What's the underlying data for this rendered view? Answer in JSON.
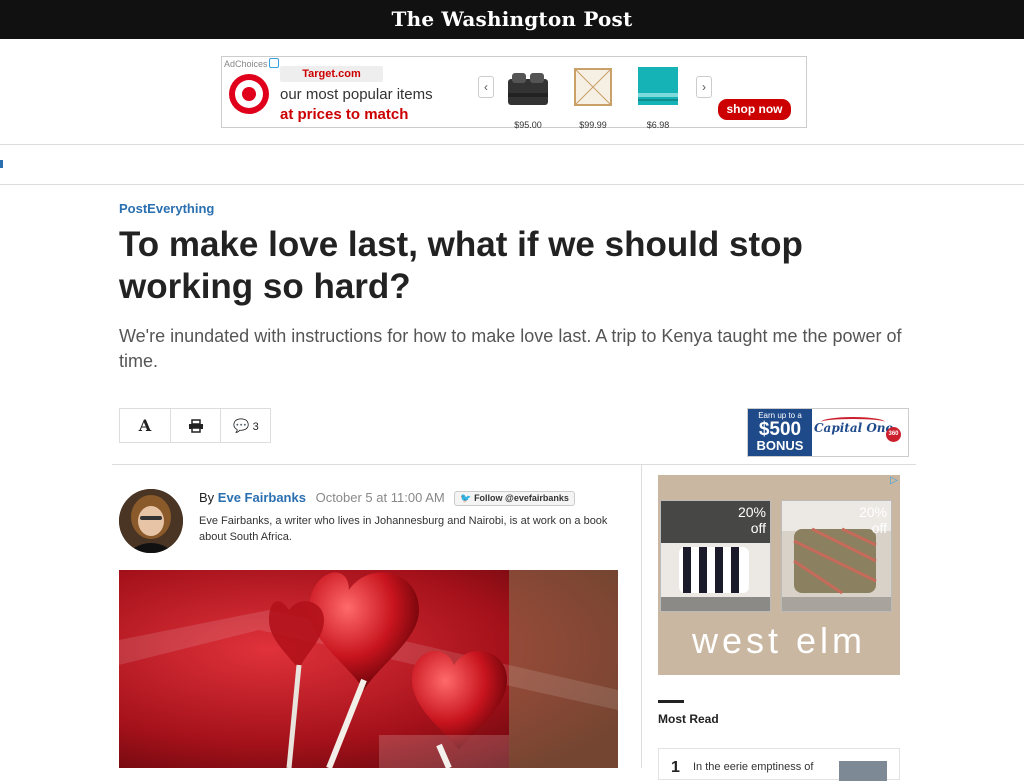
{
  "header": {
    "logo": "The Washington Post"
  },
  "ad_top": {
    "adchoices": "AdChoices",
    "advertiser_domain": "Target.com",
    "line1": "our most popular items",
    "line2": "at prices to match",
    "products": [
      {
        "price": "$95.00"
      },
      {
        "price": "$99.99"
      },
      {
        "price": "$6.98"
      }
    ],
    "prev": "‹",
    "next": "›",
    "cta": "shop now",
    "colors": {
      "brand": "#cc0000"
    }
  },
  "article": {
    "kicker": "PostEverything",
    "headline": "To make love last, what if we should stop working so hard?",
    "dek": "We're inundated with instructions for how to make love last. A trip to Kenya taught me the power of time.",
    "tools": {
      "font_icon": "A",
      "comment_count": "3"
    }
  },
  "capone_ad": {
    "small": "Earn up to a",
    "amount": "$500",
    "bonus": "BONUS",
    "brand": "Capital One",
    "badge": "360"
  },
  "byline": {
    "by": "By",
    "author": "Eve Fairbanks",
    "date": "October 5 at 11:00 AM",
    "follow": "Follow @evefairbanks",
    "bio": "Eve Fairbanks, a writer who lives in Johannesburg and Nairobi, is at work on a book about South Africa."
  },
  "sidebar_ad": {
    "tiles": [
      {
        "off_line1": "20%",
        "off_line2": "off"
      },
      {
        "off_line1": "20%",
        "off_line2": "off"
      }
    ],
    "brand": "west elm"
  },
  "most_read": {
    "title": "Most Read",
    "items": [
      {
        "num": "1",
        "text": "In the eerie emptiness of"
      }
    ]
  }
}
